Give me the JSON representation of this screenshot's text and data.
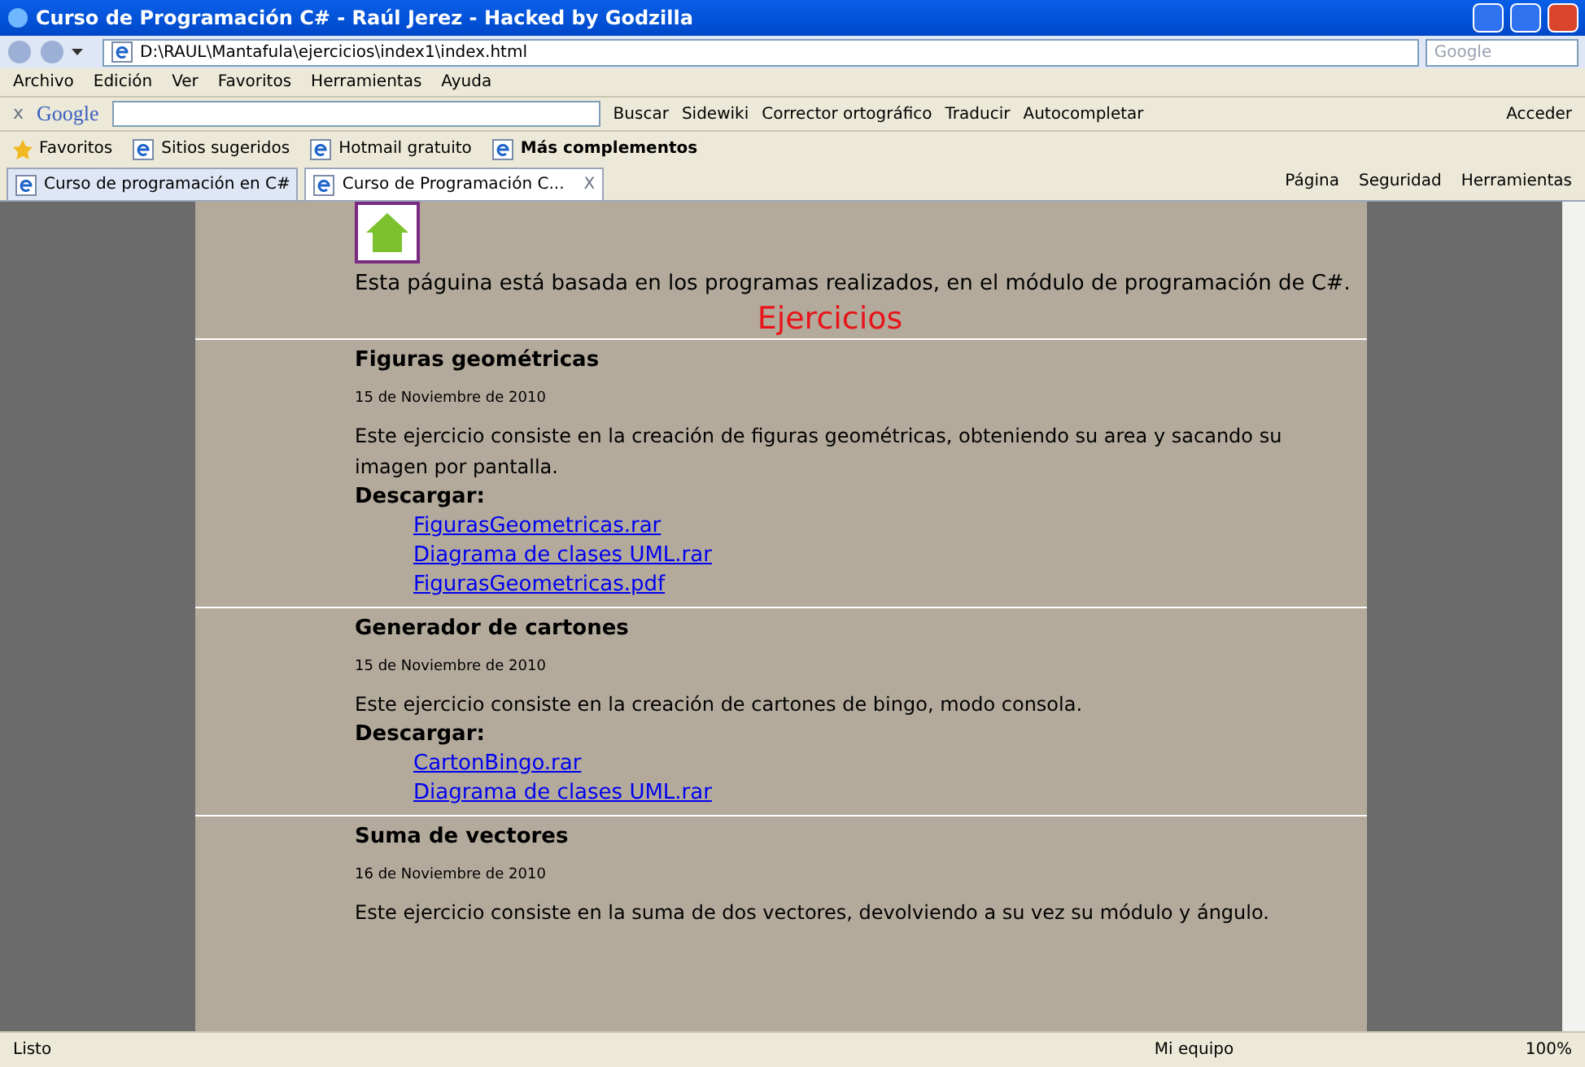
{
  "window": {
    "title": "Curso de Programación C# - Raúl Jerez - Hacked by Godzilla"
  },
  "address_bar": {
    "url": "D:\\RAUL\\Mantafula\\ejercicios\\index1\\index.html",
    "search_placeholder": "Google"
  },
  "menu": [
    "Archivo",
    "Edición",
    "Ver",
    "Favoritos",
    "Herramientas",
    "Ayuda"
  ],
  "google_toolbar": {
    "close": "x",
    "logo": "Google",
    "items": [
      "Buscar",
      "Sidewiki",
      "Corrector ortográfico",
      "Traducir",
      "Autocompletar"
    ],
    "sign_in": "Acceder"
  },
  "favorites_bar": {
    "label": "Favoritos",
    "links": [
      {
        "label": "Sitios sugeridos",
        "bold": false
      },
      {
        "label": "Hotmail gratuito",
        "bold": false
      },
      {
        "label": "Más complementos",
        "bold": true
      }
    ]
  },
  "tabs": [
    {
      "label": "Curso de programación en C#",
      "selected": false
    },
    {
      "label": "Curso de Programación C...",
      "selected": true,
      "close": "X"
    }
  ],
  "command_bar": [
    "Página",
    "Seguridad",
    "Herramientas"
  ],
  "page": {
    "intro": "Esta páguina está basada en los programas realizados, en el módulo de programación de C#.",
    "heading": "Ejercicios",
    "exercises": [
      {
        "title": "Figuras geométricas",
        "date": "15 de Noviembre de 2010",
        "description": "Este ejercicio consiste en la creación de figuras geométricas, obteniendo su area y sacando su imagen por pantalla.",
        "download_label": "Descargar:",
        "links": [
          "FigurasGeometricas.rar",
          "Diagrama de clases UML.rar",
          "FigurasGeometricas.pdf"
        ]
      },
      {
        "title": "Generador de cartones",
        "date": "15 de Noviembre de 2010",
        "description": "Este ejercicio consiste en la creación de cartones de bingo, modo consola.",
        "download_label": "Descargar:",
        "links": [
          "CartonBingo.rar",
          "Diagrama de clases UML.rar"
        ]
      },
      {
        "title": "Suma de vectores",
        "date": "16 de Noviembre de 2010",
        "description": "Este ejercicio consiste en la suma de dos vectores, devolviendo a su vez su módulo y ángulo."
      }
    ]
  },
  "status_bar": {
    "status": "Listo",
    "zone": "Mi equipo",
    "zoom": "100%"
  }
}
